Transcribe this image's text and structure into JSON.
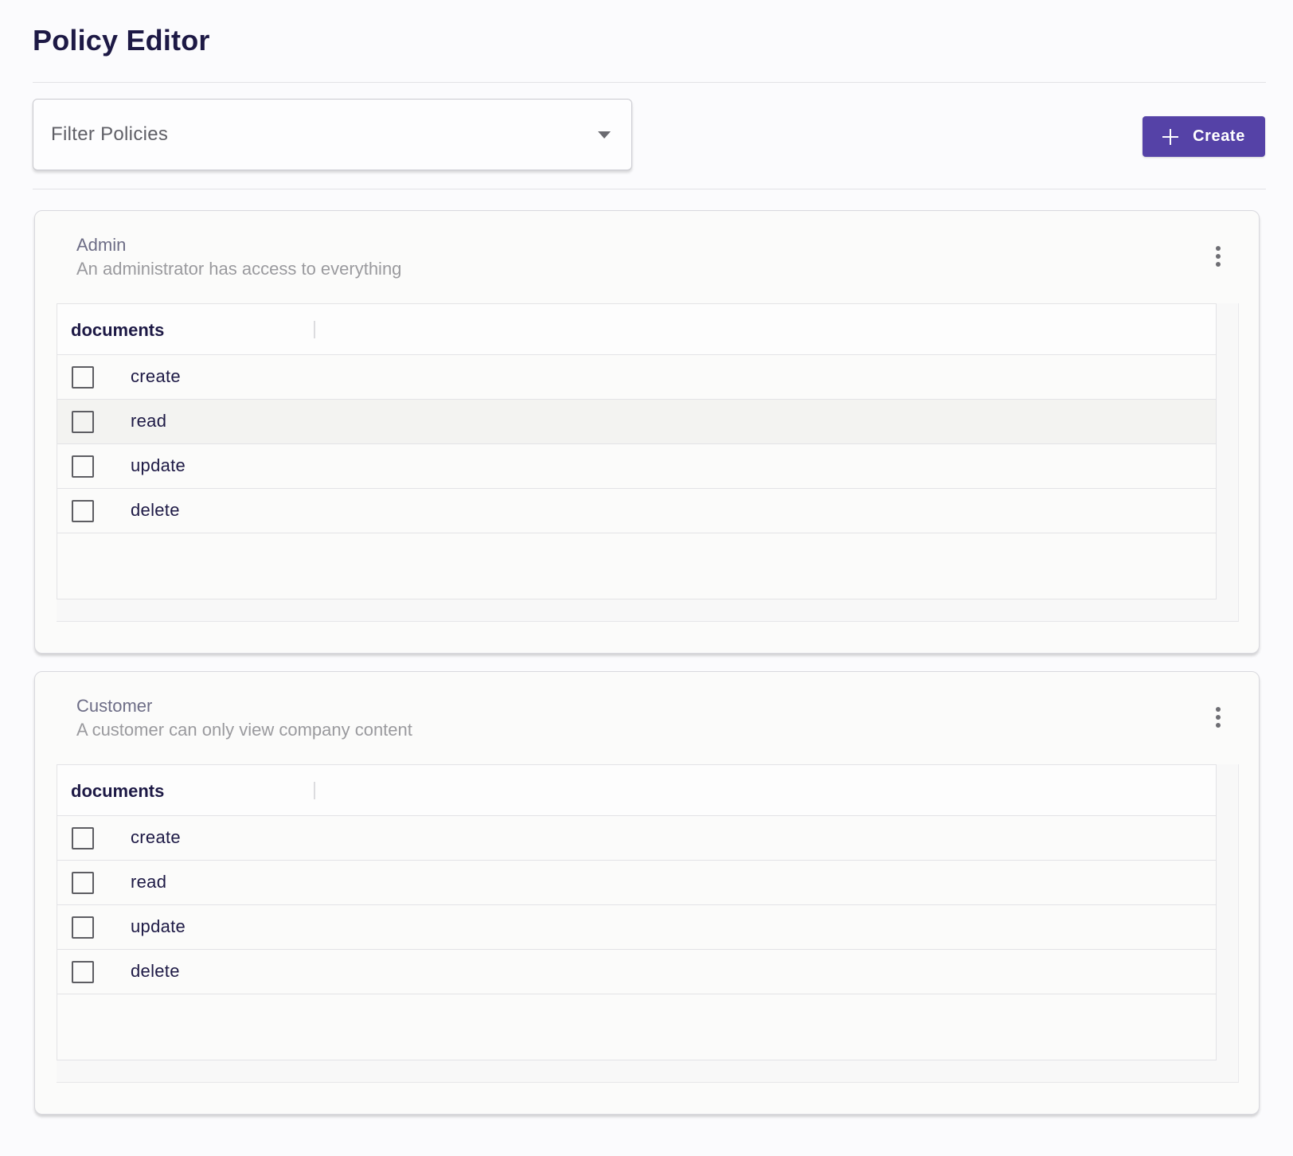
{
  "page": {
    "title": "Policy Editor"
  },
  "toolbar": {
    "filter_label": "Filter Policies",
    "create_label": "Create"
  },
  "policies": [
    {
      "name": "Admin",
      "description": "An administrator has access to everything",
      "resource": "documents",
      "permissions": [
        {
          "label": "create",
          "checked": false
        },
        {
          "label": "read",
          "checked": false
        },
        {
          "label": "update",
          "checked": false
        },
        {
          "label": "delete",
          "checked": false
        }
      ]
    },
    {
      "name": "Customer",
      "description": "A customer can only view company content",
      "resource": "documents",
      "permissions": [
        {
          "label": "create",
          "checked": false
        },
        {
          "label": "read",
          "checked": false
        },
        {
          "label": "update",
          "checked": false
        },
        {
          "label": "delete",
          "checked": false
        }
      ]
    }
  ],
  "colors": {
    "accent": "#5542a7",
    "title_text": "#1d1945",
    "background": "#fbfbfd"
  },
  "icons": {
    "create_button": "plus-icon",
    "filter_dropdown": "caret-down-icon",
    "card_menu": "more-vert-icon"
  }
}
